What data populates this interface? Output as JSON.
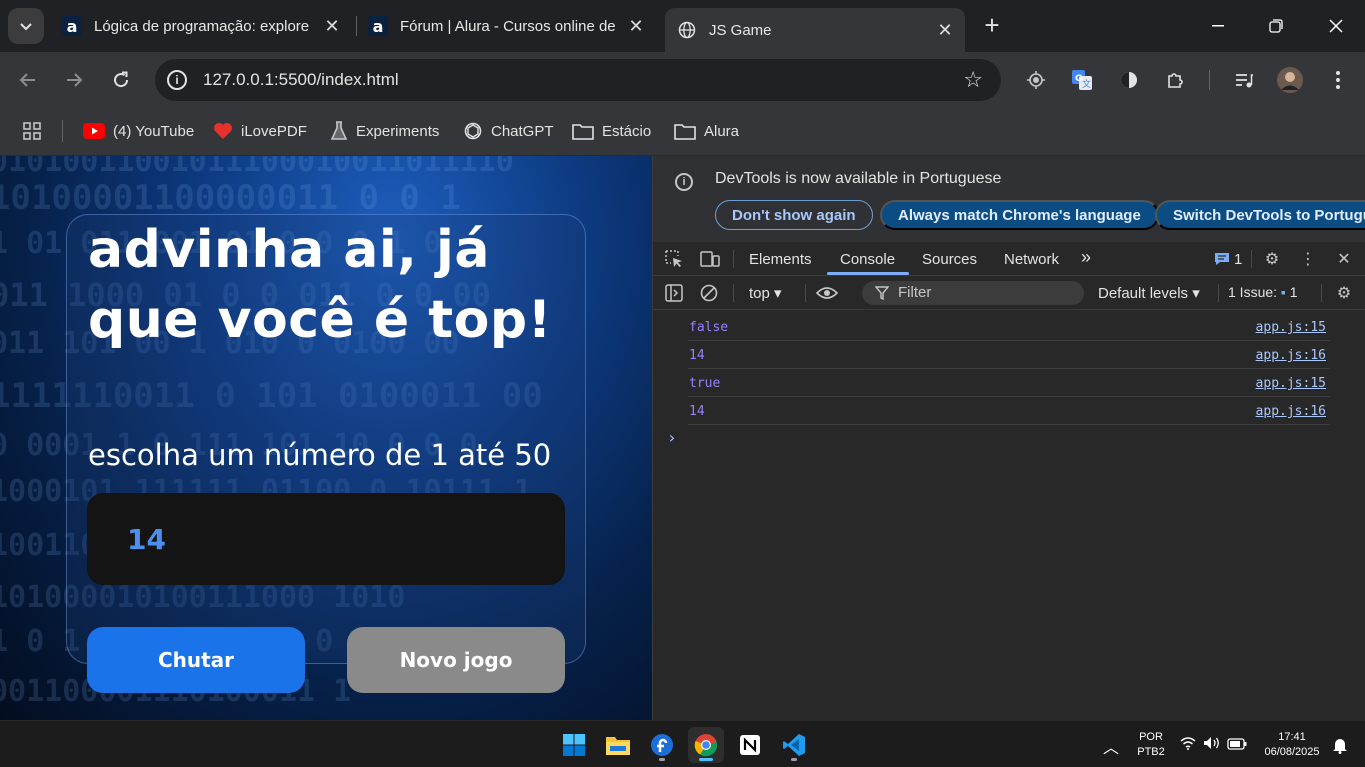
{
  "browser": {
    "tabs": [
      {
        "title": "Lógica de programação: explore",
        "favicon": "alura-a-icon"
      },
      {
        "title": "Fórum | Alura - Cursos online de",
        "favicon": "alura-a-icon"
      },
      {
        "title": "JS Game",
        "favicon": "globe-icon",
        "active": true
      }
    ],
    "url": "127.0.0.1:5500/index.html"
  },
  "bookmarks": [
    {
      "label": "(4) YouTube",
      "icon": "youtube-icon"
    },
    {
      "label": "iLovePDF",
      "icon": "ilovepdf-heart-icon"
    },
    {
      "label": "Experiments",
      "icon": "flask-icon"
    },
    {
      "label": "ChatGPT",
      "icon": "chatgpt-icon"
    },
    {
      "label": "Estácio",
      "icon": "folder-icon"
    },
    {
      "label": "Alura",
      "icon": "folder-icon"
    }
  ],
  "page": {
    "headline_line1": "advinha ai, já",
    "headline_line2": "que você é top!",
    "subtitle": "escolha um número de 1 até 50",
    "input_value": "14",
    "btn_guess": "Chutar",
    "btn_new_game": "Novo jogo",
    "binary_rows": [
      "01010011001011100010011011110",
      "10100001100000011   0 0      1",
      "  1 01 011  001 01 0  0  0  1 0",
      "  011  1000 01 0 0 011 0 0 00",
      "  011 101 00 1  010 0  0100 00",
      "1111110011 0 101 0100011 00",
      "0 0001 1 0 111 101 10  0 0   0",
      "1000101 111111 01100 0 10111 1",
      "  100110100 1011 001 01101",
      "101000010100111000 1010",
      "1 0 1 0 0 1 1 0 1 0 0 0 1 100",
      "001100001110100011 1"
    ]
  },
  "devtools": {
    "banner_message": "DevTools is now available in Portuguese",
    "btn_dont_show": "Don't show again",
    "btn_always_match": "Always match Chrome's language",
    "btn_switch": "Switch DevTools to Portuguese",
    "tabs": [
      "Elements",
      "Console",
      "Sources",
      "Network"
    ],
    "message_count": "1",
    "context": "top",
    "filter_placeholder": "Filter",
    "levels": "Default levels",
    "issues": "1 Issue:",
    "issues_count": "1",
    "logs": [
      {
        "value": "false",
        "source": "app.js:15"
      },
      {
        "value": "14",
        "source": "app.js:16"
      },
      {
        "value": "true",
        "source": "app.js:15"
      },
      {
        "value": "14",
        "source": "app.js:16"
      }
    ]
  },
  "taskbar": {
    "lang_top": "POR",
    "lang_bottom": "PTB2",
    "time": "17:41",
    "date": "06/08/2025"
  }
}
